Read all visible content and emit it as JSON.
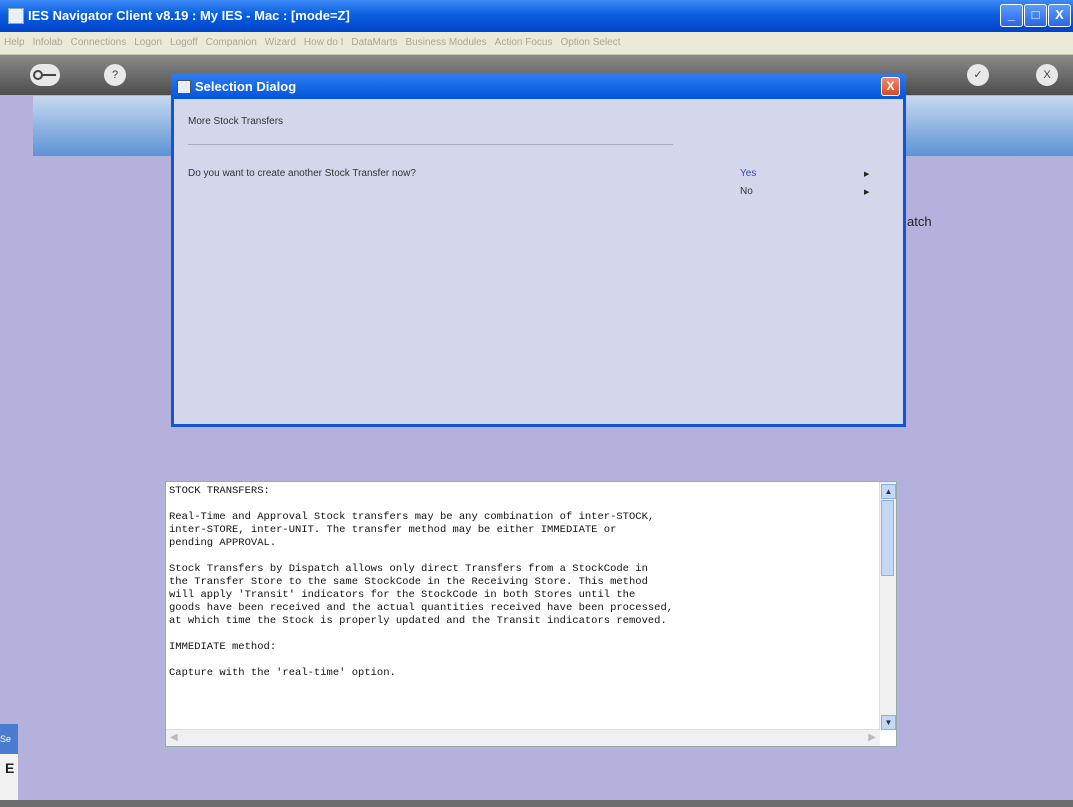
{
  "window": {
    "title": "IES Navigator Client v8.19 : My IES - Mac :      [mode=Z]",
    "minimize": "_",
    "maximize": "□",
    "close": "X"
  },
  "menu": [
    "Help",
    "Infolab",
    "Connections",
    "Logon",
    "Logoff",
    "Companion",
    "Wizard",
    "How do I",
    "DataMarts",
    "Business Modules",
    "Action Focus",
    "Option Select"
  ],
  "toolbar": {
    "help_glyph": "?",
    "ok_glyph": "✓",
    "cancel_glyph": "X"
  },
  "side_label": "atch",
  "left_tab": {
    "label": "Se",
    "letter": "E"
  },
  "dialog": {
    "title": "Selection Dialog",
    "close": "X",
    "subtitle": "More Stock Transfers",
    "question": "Do you want to create another Stock Transfer now?",
    "options": [
      {
        "label": "Yes",
        "color": "#3b44c8"
      },
      {
        "label": "No",
        "color": "#333333"
      }
    ]
  },
  "help": {
    "lines": [
      "STOCK TRANSFERS:",
      "",
      "Real-Time and Approval Stock transfers may be any combination of inter-STOCK,",
      "inter-STORE, inter-UNIT. The transfer method may be either IMMEDIATE or",
      "pending APPROVAL.",
      "",
      "Stock Transfers by Dispatch allows only direct Transfers from a StockCode in",
      "the Transfer Store to the same StockCode in the Receiving Store. This method",
      "will apply 'Transit' indicators for the StockCode in both Stores until the",
      "goods have been received and the actual quantities received have been processed,",
      "at which time the Stock is properly updated and the Transit indicators removed.",
      "",
      "IMMEDIATE method:",
      "",
      "Capture with the 'real-time' option."
    ]
  }
}
